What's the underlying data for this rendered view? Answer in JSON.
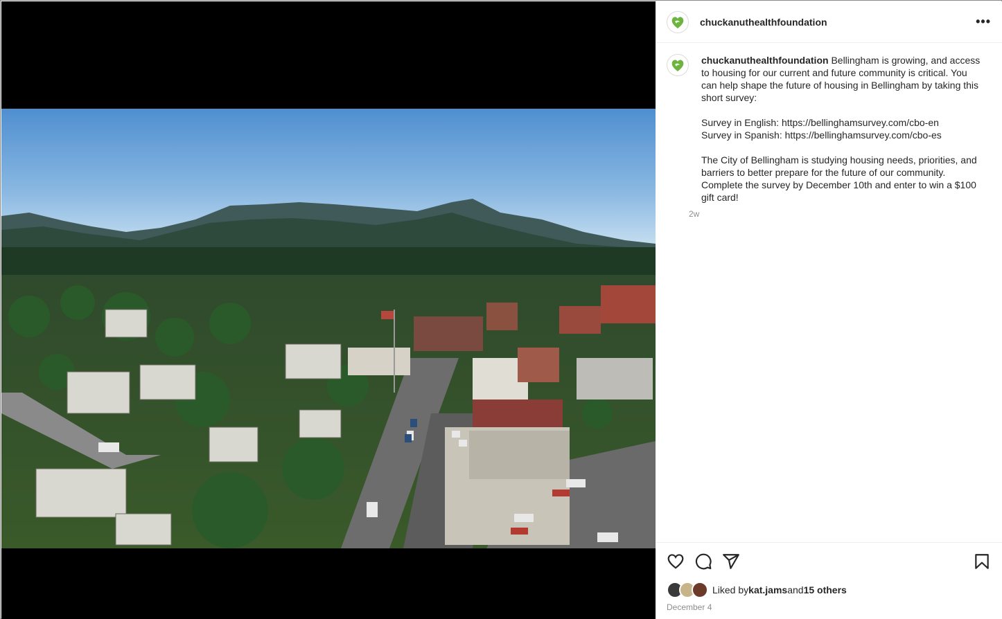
{
  "post": {
    "username": "chuckanuthealthfoundation",
    "more_label": "•••",
    "caption_user": "chuckanuthealthfoundation",
    "caption_text": " Bellingham is growing, and access to housing for our current and future community is critical. You can help shape the future of housing in Bellingham by taking this short survey:\n\nSurvey in English: https://bellinghamsurvey.com/cbo-en\nSurvey in Spanish: https://bellinghamsurvey.com/cbo-es\n\nThe City of Bellingham is studying housing needs, priorities, and barriers to better prepare for the future of our community. Complete the survey by December 10th and enter to win a $100 gift card!",
    "caption_age": "2w",
    "liked_by_prefix": "Liked by ",
    "liked_by_user": "kat.jams",
    "liked_by_mid": " and ",
    "liked_by_others": "15 others",
    "date": "December 4"
  },
  "icons": {
    "like": "heart-icon",
    "comment": "comment-icon",
    "share": "share-icon",
    "save": "bookmark-icon",
    "more": "more-icon"
  },
  "colors": {
    "logo_green": "#6cb33f",
    "sky": "#5e9ad3",
    "text": "#262626",
    "muted": "#8e8e8e"
  }
}
